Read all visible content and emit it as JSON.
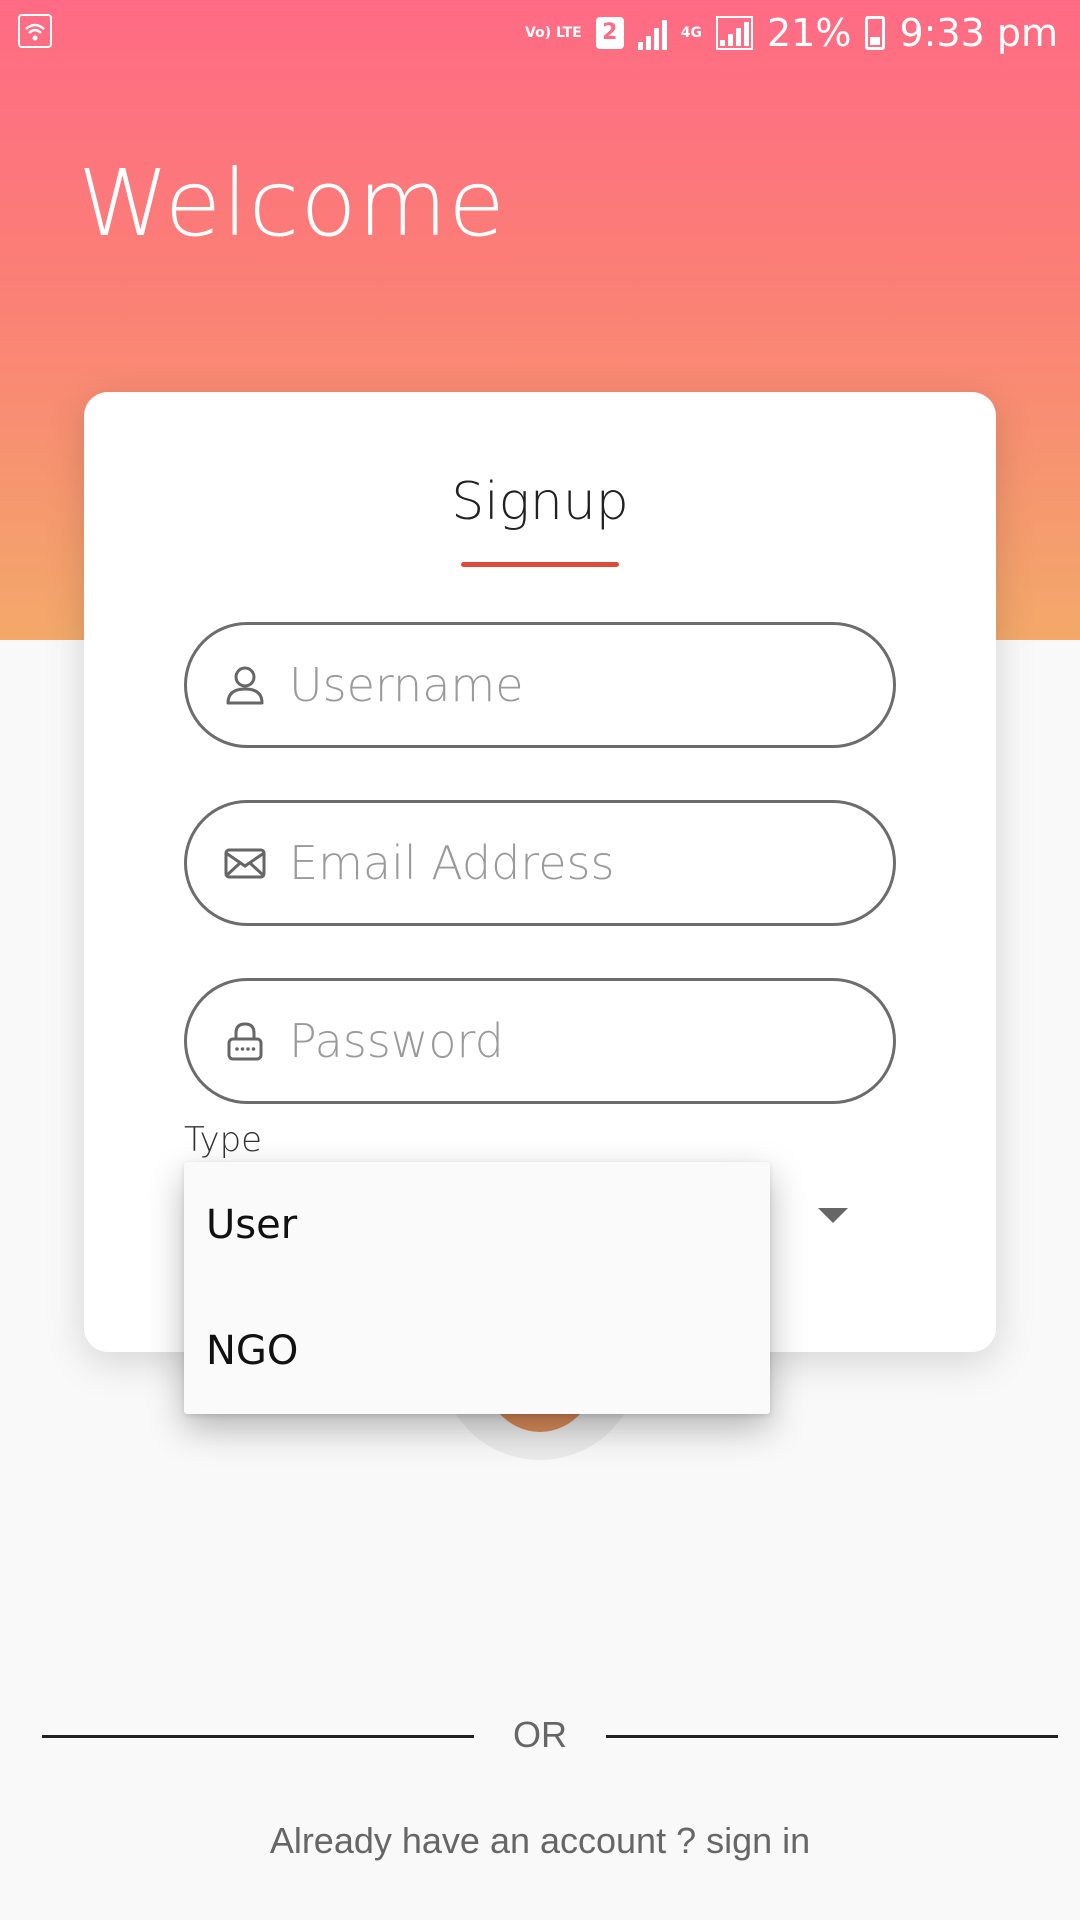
{
  "status_bar": {
    "network_label": "Vo) LTE",
    "sim_badge": "2",
    "network_type": "4G",
    "battery": "21%",
    "time": "9:33 pm"
  },
  "header": {
    "title": "Welcome"
  },
  "form": {
    "title": "Signup",
    "username_placeholder": "Username",
    "email_placeholder": "Email Address",
    "password_placeholder": "Password",
    "type_label": "Type"
  },
  "dropdown": {
    "options": [
      "User",
      "NGO"
    ]
  },
  "footer": {
    "or_label": "OR",
    "signin_text": "Already have an account ? sign in"
  },
  "colors": {
    "gradient_top": "#ff6b85",
    "gradient_bottom": "#f3a96a",
    "accent_underline": "#dd4b39",
    "background": "#f9f9f9"
  }
}
